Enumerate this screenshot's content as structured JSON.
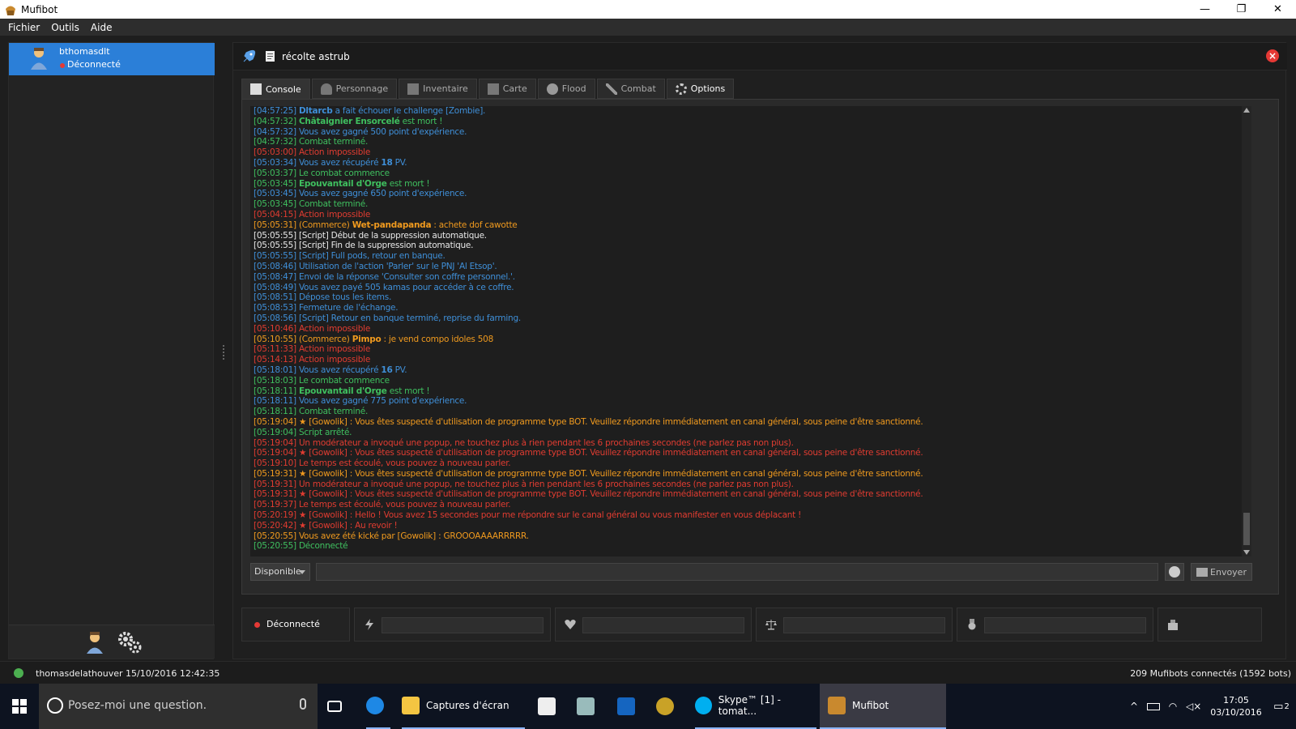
{
  "window": {
    "title": "Mufibot",
    "minimize": "—",
    "restore": "❐",
    "close": "✕"
  },
  "menu": [
    "Fichier",
    "Outils",
    "Aide"
  ],
  "account": {
    "name": "bthomasdlt",
    "status": "Déconnecté"
  },
  "script": {
    "name": "récolte astrub"
  },
  "tabs": [
    "Console",
    "Personnage",
    "Inventaire",
    "Carte",
    "Flood",
    "Combat",
    "Options"
  ],
  "log": [
    {
      "c": "c-blue",
      "t": "[04:57:25] ",
      "b": "Dltarcb",
      "r": " a fait échouer le challenge [Zombie]."
    },
    {
      "c": "c-green",
      "t": "[04:57:32] ",
      "b": "Châtaignier Ensorcelé",
      "r": " est mort !"
    },
    {
      "c": "c-blue",
      "t": "[04:57:32] Vous avez gagné 500 point d'expérience.",
      "b": "",
      "r": ""
    },
    {
      "c": "c-green",
      "t": "[04:57:32] Combat terminé.",
      "b": "",
      "r": ""
    },
    {
      "c": "c-red",
      "t": "[05:03:00] Action impossible",
      "b": "",
      "r": ""
    },
    {
      "c": "c-blue",
      "t": "[05:03:34] Vous avez récupéré ",
      "b": "18",
      "r": " PV."
    },
    {
      "c": "c-green",
      "t": "[05:03:37] Le combat commence",
      "b": "",
      "r": ""
    },
    {
      "c": "c-green",
      "t": "[05:03:45] ",
      "b": "Epouvantail d'Orge",
      "r": " est mort !"
    },
    {
      "c": "c-blue",
      "t": "[05:03:45] Vous avez gagné 650 point d'expérience.",
      "b": "",
      "r": ""
    },
    {
      "c": "c-green",
      "t": "[05:03:45] Combat terminé.",
      "b": "",
      "r": ""
    },
    {
      "c": "c-red",
      "t": "[05:04:15] Action impossible",
      "b": "",
      "r": ""
    },
    {
      "c": "c-orange",
      "t": "[05:05:31] (Commerce) ",
      "b": "Wet-pandapanda",
      "r": " : achete dof cawotte"
    },
    {
      "c": "c-white",
      "t": "[05:05:55] [Script] Début de la suppression automatique.",
      "b": "",
      "r": ""
    },
    {
      "c": "c-white",
      "t": "[05:05:55] [Script] Fin de la suppression automatique.",
      "b": "",
      "r": ""
    },
    {
      "c": "c-blue",
      "t": "[05:05:55] [Script] Full pods, retour en banque.",
      "b": "",
      "r": ""
    },
    {
      "c": "c-blue",
      "t": "[05:08:46] Utilisation de l'action 'Parler' sur le PNJ 'Al Etsop'.",
      "b": "",
      "r": ""
    },
    {
      "c": "c-blue",
      "t": "[05:08:47] Envoi de la réponse 'Consulter son coffre personnel.'.",
      "b": "",
      "r": ""
    },
    {
      "c": "c-blue",
      "t": "[05:08:49] Vous avez payé 505 kamas pour accéder à ce coffre.",
      "b": "",
      "r": ""
    },
    {
      "c": "c-blue",
      "t": "[05:08:51] Dépose tous les items.",
      "b": "",
      "r": ""
    },
    {
      "c": "c-blue",
      "t": "[05:08:53] Fermeture de l'échange.",
      "b": "",
      "r": ""
    },
    {
      "c": "c-blue",
      "t": "[05:08:56] [Script] Retour en banque terminé, reprise du farming.",
      "b": "",
      "r": ""
    },
    {
      "c": "c-red",
      "t": "[05:10:46] Action impossible",
      "b": "",
      "r": ""
    },
    {
      "c": "c-orange",
      "t": "[05:10:55] (Commerce) ",
      "b": "Pimpo",
      "r": " : je vend compo idoles 508"
    },
    {
      "c": "c-red",
      "t": "[05:11:33] Action impossible",
      "b": "",
      "r": ""
    },
    {
      "c": "c-red",
      "t": "[05:14:13] Action impossible",
      "b": "",
      "r": ""
    },
    {
      "c": "c-blue",
      "t": "[05:18:01] Vous avez récupéré ",
      "b": "16",
      "r": " PV."
    },
    {
      "c": "c-green",
      "t": "[05:18:03] Le combat commence",
      "b": "",
      "r": ""
    },
    {
      "c": "c-green",
      "t": "[05:18:11] ",
      "b": "Epouvantail d'Orge",
      "r": " est mort !"
    },
    {
      "c": "c-blue",
      "t": "[05:18:11] Vous avez gagné 775 point d'expérience.",
      "b": "",
      "r": ""
    },
    {
      "c": "c-green",
      "t": "[05:18:11] Combat terminé.",
      "b": "",
      "r": ""
    },
    {
      "c": "c-orange",
      "t": "[05:19:04] ★ [Gowolik] : Vous êtes suspecté d'utilisation de programme type BOT. Veuillez répondre immédiatement en canal général, sous peine d'être sanctionné.",
      "b": "",
      "r": ""
    },
    {
      "c": "c-green",
      "t": "[05:19:04] Script arrêté.",
      "b": "",
      "r": ""
    },
    {
      "c": "c-red",
      "t": "[05:19:04] Un modérateur a invoqué une popup, ne touchez plus à rien pendant les 6 prochaines secondes (ne parlez pas non plus).",
      "b": "",
      "r": ""
    },
    {
      "c": "c-red",
      "t": "[05:19:04] ★ [Gowolik] : Vous êtes suspecté d'utilisation de programme type BOT. Veuillez répondre immédiatement en canal général, sous peine d'être sanctionné.",
      "b": "",
      "r": ""
    },
    {
      "c": "c-red",
      "t": "[05:19:10] Le temps est écoulé, vous pouvez à nouveau parler.",
      "b": "",
      "r": ""
    },
    {
      "c": "c-orange",
      "t": "[05:19:31] ★ [Gowolik] : Vous êtes suspecté d'utilisation de programme type BOT. Veuillez répondre immédiatement en canal général, sous peine d'être sanctionné.",
      "b": "",
      "r": ""
    },
    {
      "c": "c-red",
      "t": "[05:19:31] Un modérateur a invoqué une popup, ne touchez plus à rien pendant les 6 prochaines secondes (ne parlez pas non plus).",
      "b": "",
      "r": ""
    },
    {
      "c": "c-red",
      "t": "[05:19:31] ★ [Gowolik] : Vous êtes suspecté d'utilisation de programme type BOT. Veuillez répondre immédiatement en canal général, sous peine d'être sanctionné.",
      "b": "",
      "r": ""
    },
    {
      "c": "c-red",
      "t": "[05:19:37] Le temps est écoulé, vous pouvez à nouveau parler.",
      "b": "",
      "r": ""
    },
    {
      "c": "c-red",
      "t": "[05:20:19] ★ [Gowolik] : Hello ! Vous avez 15 secondes pour me répondre sur le canal général ou vous manifester en vous déplacant !",
      "b": "",
      "r": ""
    },
    {
      "c": "c-red",
      "t": "[05:20:42] ★ [Gowolik] : Au revoir !",
      "b": "",
      "r": ""
    },
    {
      "c": "c-orange",
      "t": "[05:20:55] Vous avez été kické par [Gowolik] : GROOOAAAARRRRR.",
      "b": "",
      "r": ""
    },
    {
      "c": "c-green",
      "t": "[05:20:55] Déconnecté",
      "b": "",
      "r": ""
    }
  ],
  "input": {
    "status_select": "Disponible",
    "send_label": "Envoyer"
  },
  "bottom": {
    "connection": "Déconnecté"
  },
  "statusbar": {
    "user": "thomasdelathouver  15/10/2016 12:42:35",
    "count": "209 Mufibots connectés (1592 bots)"
  },
  "taskbar": {
    "search_placeholder": "Posez-moi une question.",
    "explorer_label": "Captures d'écran",
    "skype_label": "Skype™ [1] - tomat...",
    "mufibot_label": "Mufibot",
    "time": "17:05",
    "date": "03/10/2016",
    "notif_count": "2"
  },
  "colors": {
    "accent": "#2b7fd8",
    "blue": "#3f8fd8",
    "green": "#3fbf5f",
    "red": "#e03c31",
    "orange": "#f09a1e"
  }
}
